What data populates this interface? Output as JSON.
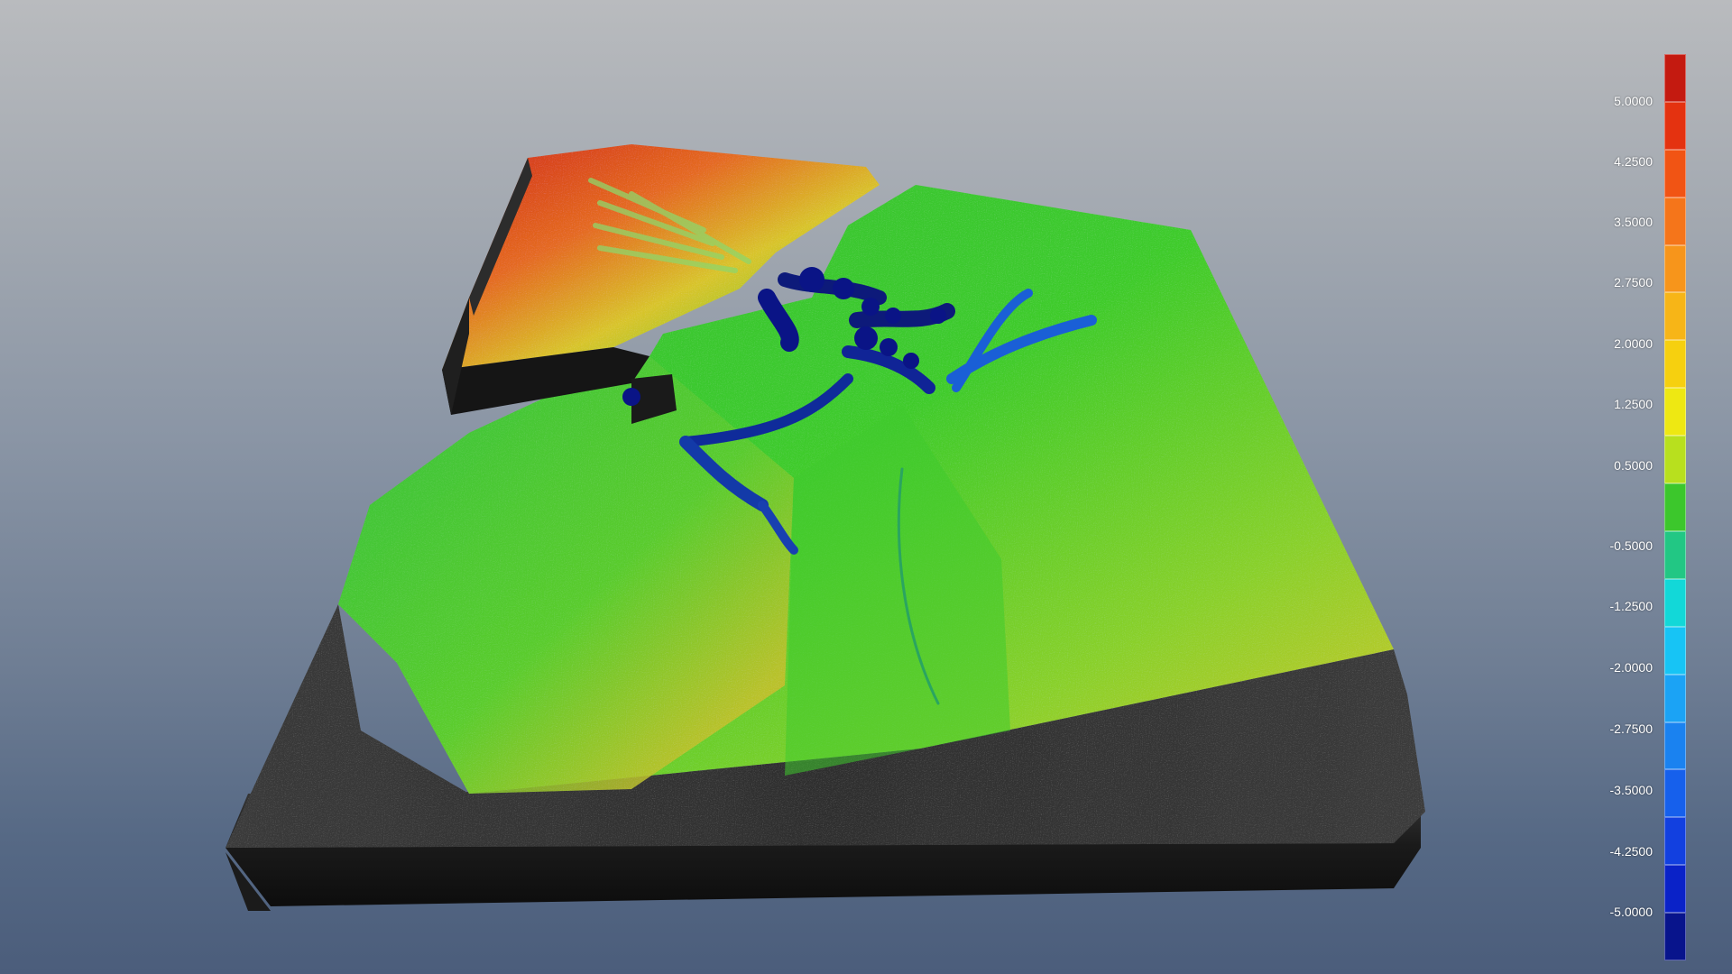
{
  "colors": {
    "high": "#c41a10",
    "mid_high": "#f39a12",
    "zero": "#35c92c",
    "mid_low": "#19a6f0",
    "low": "#0a1486",
    "base": "#2a2a2a"
  },
  "legend": {
    "swatches": [
      "#c41a10",
      "#e43210",
      "#f15414",
      "#f5751a",
      "#f7951b",
      "#f7b517",
      "#f6d00f",
      "#eee812",
      "#b8e01e",
      "#3cc72c",
      "#22c784",
      "#12d8d8",
      "#17c4f5",
      "#1ba3f5",
      "#1a82f0",
      "#1660ec",
      "#1240e0",
      "#0a22c8",
      "#08148c"
    ],
    "labels": [
      "5.0000",
      "4.2500",
      "3.5000",
      "2.7500",
      "2.0000",
      "1.2500",
      "0.5000",
      "-0.5000",
      "-1.2500",
      "-2.0000",
      "-2.7500",
      "-3.5000",
      "-4.2500",
      "-5.0000"
    ]
  }
}
